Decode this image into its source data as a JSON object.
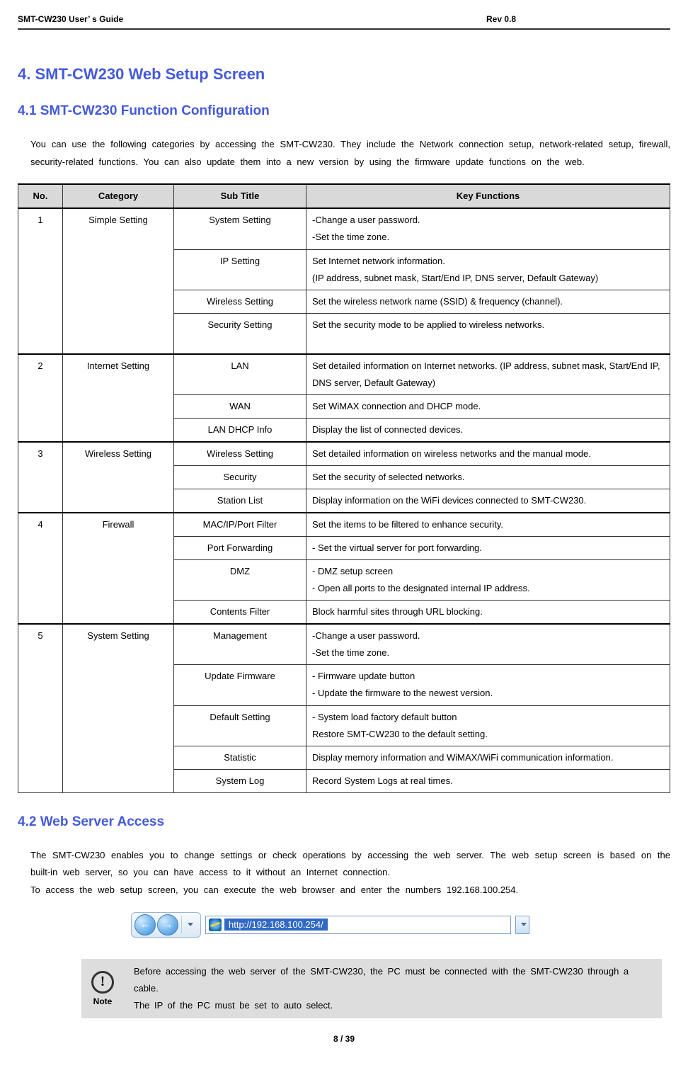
{
  "header": {
    "left": "SMT-CW230 User’ s Guide",
    "center": "Rev 0.8"
  },
  "h2": "4. SMT-CW230 Web Setup Screen",
  "section41": {
    "title": "4.1 SMT-CW230 Function Configuration",
    "para": "You can use the following categories by accessing the SMT-CW230. They include the Network connection setup, network-related setup, firewall, security-related functions. You can also update them into a new version by using the firmware update functions on the web."
  },
  "table": {
    "headers": {
      "no": "No.",
      "cat": "Category",
      "sub": "Sub Title",
      "key": "Key Functions"
    },
    "groups": [
      {
        "no": "1",
        "category": "Simple Setting",
        "rows": [
          {
            "sub": "System Setting",
            "key": "-Change a user password.\n-Set the time zone."
          },
          {
            "sub": "IP Setting",
            "key": "Set Internet network information.\n(IP address, subnet mask, Start/End IP, DNS server, Default Gateway)"
          },
          {
            "sub": "Wireless Setting",
            "key": "Set the wireless network name (SSID) & frequency (channel)."
          },
          {
            "sub": "Security Setting",
            "key": "Set the security mode to be applied to wireless networks.\n "
          }
        ]
      },
      {
        "no": "2",
        "category": "Internet Setting",
        "rows": [
          {
            "sub": "LAN",
            "key": "Set detailed information on Internet networks. (IP address, subnet mask, Start/End IP, DNS server, Default Gateway)"
          },
          {
            "sub": "WAN",
            "key": "Set WiMAX connection and DHCP mode."
          },
          {
            "sub": "LAN DHCP Info",
            "key": "Display the list of connected devices."
          }
        ]
      },
      {
        "no": "3",
        "category": "Wireless Setting",
        "rows": [
          {
            "sub": "Wireless Setting",
            "key": "Set detailed information on wireless networks and the manual mode."
          },
          {
            "sub": "Security",
            "key": "Set the security of selected networks."
          },
          {
            "sub": "Station List",
            "key": "Display information on the WiFi devices connected to SMT-CW230."
          }
        ]
      },
      {
        "no": "4",
        "category": "Firewall",
        "rows": [
          {
            "sub": "MAC/IP/Port Filter",
            "key": "Set the items to be filtered to enhance security."
          },
          {
            "sub": "Port Forwarding",
            "key": "- Set the virtual server for port forwarding."
          },
          {
            "sub": "DMZ",
            "key": "- DMZ setup screen\n- Open all ports to the designated internal IP address."
          },
          {
            "sub": "Contents Filter",
            "key": "Block harmful sites through URL blocking."
          }
        ]
      },
      {
        "no": "5",
        "category": "System Setting",
        "rows": [
          {
            "sub": "Management",
            "key": "-Change a user password.\n-Set the time zone."
          },
          {
            "sub": "Update Firmware",
            "key": "- Firmware update button\n- Update the firmware to the newest version."
          },
          {
            "sub": "Default Setting",
            "key": "- System load factory default button\nRestore SMT-CW230 to the default setting."
          },
          {
            "sub": "Statistic",
            "key": "Display memory information and WiMAX/WiFi communication information."
          },
          {
            "sub": "System Log",
            "key": "Record System Logs at real times."
          }
        ]
      }
    ]
  },
  "section42": {
    "title": "4.2 Web Server Access",
    "para1": "The SMT-CW230 enables you to change settings or check operations by accessing the web server. The web setup screen is based on the built-in web server, so you can have access to it without an Internet connection.",
    "para2": "To access the web setup screen, you can execute the web browser and enter the numbers 192.168.100.254."
  },
  "addressBar": {
    "back": "←",
    "forward": "→",
    "url": "http://192.168.100.254/"
  },
  "note": {
    "label": "Note",
    "body": "Before accessing the web server of the SMT-CW230, the PC must be connected with the SMT-CW230 through a cable.\nThe IP of the PC must be set to auto select."
  },
  "pageNum": "8 / 39"
}
